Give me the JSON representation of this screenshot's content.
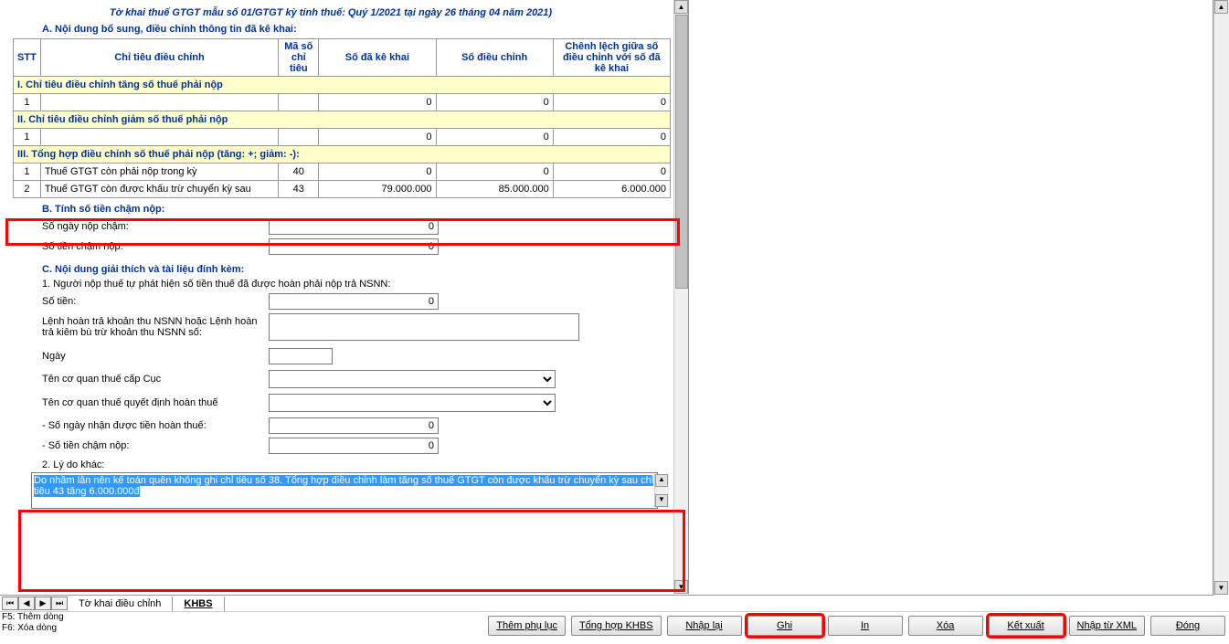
{
  "form_title": "Tờ khai thuế GTGT mẫu số 01/GTGT kỳ tính thuế: Quý 1/2021 tại ngày 26 tháng 04 năm 2021)",
  "section_a_title": "A. Nội dung bổ sung, điều chỉnh thông tin đã kê khai:",
  "headers": {
    "stt": "STT",
    "chitieu": "Chỉ tiêu điều chỉnh",
    "maso": "Mã số chỉ tiêu",
    "da_ke_khai": "Số đã kê khai",
    "dieu_chinh": "Số điều chỉnh",
    "chenh_lech": "Chênh lệch giữa số điều chỉnh với số đã kê khai"
  },
  "group_i": "I. Chỉ tiêu điều chỉnh tăng số thuế phải nộp",
  "group_ii": "II. Chỉ tiêu điều chỉnh giảm số thuế phải nộp",
  "group_iii": "III. Tổng hợp điều chỉnh số thuế phải nộp (tăng: +; giảm: -):",
  "rows": {
    "g1_r1": {
      "stt": "1",
      "label": "",
      "ms": "",
      "v1": "0",
      "v2": "0",
      "v3": "0"
    },
    "g2_r1": {
      "stt": "1",
      "label": "",
      "ms": "",
      "v1": "0",
      "v2": "0",
      "v3": "0"
    },
    "g3_r1": {
      "stt": "1",
      "label": "Thuế GTGT còn phải nộp trong kỳ",
      "ms": "40",
      "v1": "0",
      "v2": "0",
      "v3": "0"
    },
    "g3_r2": {
      "stt": "2",
      "label": "Thuế GTGT còn được khấu trừ chuyển kỳ sau",
      "ms": "43",
      "v1": "79.000.000",
      "v2": "85.000.000",
      "v3": "6.000.000"
    }
  },
  "section_b_title": "B. Tính số tiền chậm nộp:",
  "fields": {
    "so_ngay_nop_cham_label": "Số ngày nộp chậm:",
    "so_ngay_nop_cham": "0",
    "so_tien_cham_nop_label": "Số tiền chậm nộp:",
    "so_tien_cham_nop": "0"
  },
  "section_c_title": "C. Nội dung giải thích và tài liệu đính kèm:",
  "c1_label": "1. Người nộp thuế tự phát hiện số tiền thuế đã được hoàn phải nộp trả NSNN:",
  "c_fields": {
    "so_tien_label": "Số tiền:",
    "so_tien": "0",
    "lenh_label": "Lệnh hoàn trả khoản thu NSNN hoặc Lệnh hoàn trả kiêm bù trừ khoản thu NSNN số:",
    "lenh": "",
    "ngay_label": "Ngày",
    "ngay": "",
    "cuc_label": "Tên cơ quan thuế cấp Cục",
    "cuc": "",
    "quyet_dinh_label": "Tên cơ quan thuế quyết định hoàn thuế",
    "quyet_dinh": "",
    "so_ngay_nhan_label": "- Số ngày nhận được tiền hoàn thuế:",
    "so_ngay_nhan": "0",
    "so_tien_cham_nop2_label": "- Số tiền chậm nộp:",
    "so_tien_cham_nop2": "0"
  },
  "c2_label": "2. Lý do khác:",
  "reason_text": "Do nhầm lẫn nên kế toán quên không ghi chỉ tiêu số 38. Tổng hợp điều chỉnh làm tăng số thuế GTGT còn được khấu trừ chuyển kỳ sau chỉ tiêu 43 tăng 6.000.000đ",
  "tabs": {
    "t1": "Tờ khai điều chỉnh",
    "t2": "KHBS"
  },
  "info_left": {
    "l1": "F5: Thêm dòng",
    "l2": "F6: Xóa dòng"
  },
  "buttons": {
    "them_phu_luc": "Thêm phụ lục",
    "tong_hop": "Tổng hợp KHBS",
    "nhap_lai": "Nhập lại",
    "ghi": "Ghi",
    "in": "In",
    "xoa": "Xóa",
    "ket_xuat": "Kết xuất",
    "nhap_xml": "Nhập từ XML",
    "dong": "Đóng"
  }
}
